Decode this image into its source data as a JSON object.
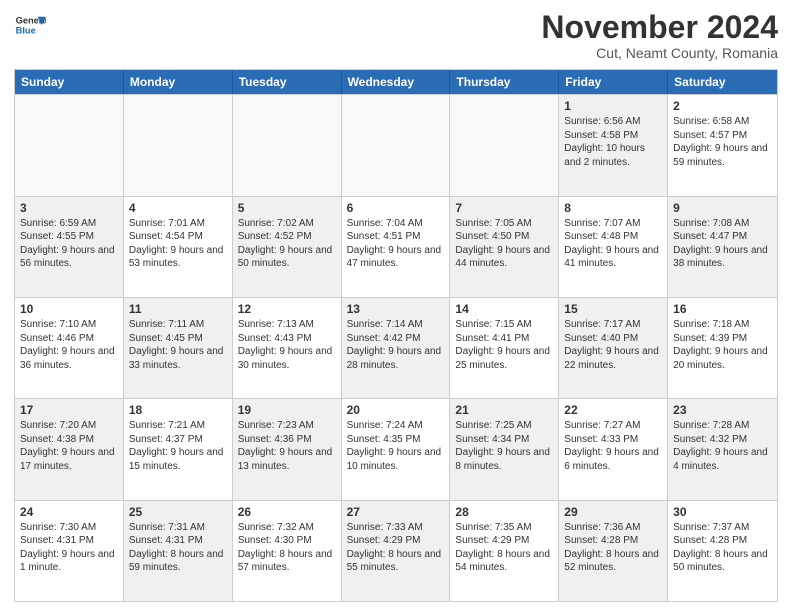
{
  "logo": {
    "line1": "General",
    "line2": "Blue"
  },
  "title": "November 2024",
  "subtitle": "Cut, Neamt County, Romania",
  "weekdays": [
    "Sunday",
    "Monday",
    "Tuesday",
    "Wednesday",
    "Thursday",
    "Friday",
    "Saturday"
  ],
  "rows": [
    [
      {
        "day": "",
        "info": "",
        "empty": true
      },
      {
        "day": "",
        "info": "",
        "empty": true
      },
      {
        "day": "",
        "info": "",
        "empty": true
      },
      {
        "day": "",
        "info": "",
        "empty": true
      },
      {
        "day": "",
        "info": "",
        "empty": true
      },
      {
        "day": "1",
        "info": "Sunrise: 6:56 AM\nSunset: 4:58 PM\nDaylight: 10 hours and 2 minutes.",
        "shaded": true
      },
      {
        "day": "2",
        "info": "Sunrise: 6:58 AM\nSunset: 4:57 PM\nDaylight: 9 hours and 59 minutes.",
        "shaded": false
      }
    ],
    [
      {
        "day": "3",
        "info": "Sunrise: 6:59 AM\nSunset: 4:55 PM\nDaylight: 9 hours and 56 minutes.",
        "shaded": true
      },
      {
        "day": "4",
        "info": "Sunrise: 7:01 AM\nSunset: 4:54 PM\nDaylight: 9 hours and 53 minutes.",
        "shaded": false
      },
      {
        "day": "5",
        "info": "Sunrise: 7:02 AM\nSunset: 4:52 PM\nDaylight: 9 hours and 50 minutes.",
        "shaded": true
      },
      {
        "day": "6",
        "info": "Sunrise: 7:04 AM\nSunset: 4:51 PM\nDaylight: 9 hours and 47 minutes.",
        "shaded": false
      },
      {
        "day": "7",
        "info": "Sunrise: 7:05 AM\nSunset: 4:50 PM\nDaylight: 9 hours and 44 minutes.",
        "shaded": true
      },
      {
        "day": "8",
        "info": "Sunrise: 7:07 AM\nSunset: 4:48 PM\nDaylight: 9 hours and 41 minutes.",
        "shaded": false
      },
      {
        "day": "9",
        "info": "Sunrise: 7:08 AM\nSunset: 4:47 PM\nDaylight: 9 hours and 38 minutes.",
        "shaded": true
      }
    ],
    [
      {
        "day": "10",
        "info": "Sunrise: 7:10 AM\nSunset: 4:46 PM\nDaylight: 9 hours and 36 minutes.",
        "shaded": false
      },
      {
        "day": "11",
        "info": "Sunrise: 7:11 AM\nSunset: 4:45 PM\nDaylight: 9 hours and 33 minutes.",
        "shaded": true
      },
      {
        "day": "12",
        "info": "Sunrise: 7:13 AM\nSunset: 4:43 PM\nDaylight: 9 hours and 30 minutes.",
        "shaded": false
      },
      {
        "day": "13",
        "info": "Sunrise: 7:14 AM\nSunset: 4:42 PM\nDaylight: 9 hours and 28 minutes.",
        "shaded": true
      },
      {
        "day": "14",
        "info": "Sunrise: 7:15 AM\nSunset: 4:41 PM\nDaylight: 9 hours and 25 minutes.",
        "shaded": false
      },
      {
        "day": "15",
        "info": "Sunrise: 7:17 AM\nSunset: 4:40 PM\nDaylight: 9 hours and 22 minutes.",
        "shaded": true
      },
      {
        "day": "16",
        "info": "Sunrise: 7:18 AM\nSunset: 4:39 PM\nDaylight: 9 hours and 20 minutes.",
        "shaded": false
      }
    ],
    [
      {
        "day": "17",
        "info": "Sunrise: 7:20 AM\nSunset: 4:38 PM\nDaylight: 9 hours and 17 minutes.",
        "shaded": true
      },
      {
        "day": "18",
        "info": "Sunrise: 7:21 AM\nSunset: 4:37 PM\nDaylight: 9 hours and 15 minutes.",
        "shaded": false
      },
      {
        "day": "19",
        "info": "Sunrise: 7:23 AM\nSunset: 4:36 PM\nDaylight: 9 hours and 13 minutes.",
        "shaded": true
      },
      {
        "day": "20",
        "info": "Sunrise: 7:24 AM\nSunset: 4:35 PM\nDaylight: 9 hours and 10 minutes.",
        "shaded": false
      },
      {
        "day": "21",
        "info": "Sunrise: 7:25 AM\nSunset: 4:34 PM\nDaylight: 9 hours and 8 minutes.",
        "shaded": true
      },
      {
        "day": "22",
        "info": "Sunrise: 7:27 AM\nSunset: 4:33 PM\nDaylight: 9 hours and 6 minutes.",
        "shaded": false
      },
      {
        "day": "23",
        "info": "Sunrise: 7:28 AM\nSunset: 4:32 PM\nDaylight: 9 hours and 4 minutes.",
        "shaded": true
      }
    ],
    [
      {
        "day": "24",
        "info": "Sunrise: 7:30 AM\nSunset: 4:31 PM\nDaylight: 9 hours and 1 minute.",
        "shaded": false
      },
      {
        "day": "25",
        "info": "Sunrise: 7:31 AM\nSunset: 4:31 PM\nDaylight: 8 hours and 59 minutes.",
        "shaded": true
      },
      {
        "day": "26",
        "info": "Sunrise: 7:32 AM\nSunset: 4:30 PM\nDaylight: 8 hours and 57 minutes.",
        "shaded": false
      },
      {
        "day": "27",
        "info": "Sunrise: 7:33 AM\nSunset: 4:29 PM\nDaylight: 8 hours and 55 minutes.",
        "shaded": true
      },
      {
        "day": "28",
        "info": "Sunrise: 7:35 AM\nSunset: 4:29 PM\nDaylight: 8 hours and 54 minutes.",
        "shaded": false
      },
      {
        "day": "29",
        "info": "Sunrise: 7:36 AM\nSunset: 4:28 PM\nDaylight: 8 hours and 52 minutes.",
        "shaded": true
      },
      {
        "day": "30",
        "info": "Sunrise: 7:37 AM\nSunset: 4:28 PM\nDaylight: 8 hours and 50 minutes.",
        "shaded": false
      }
    ]
  ]
}
